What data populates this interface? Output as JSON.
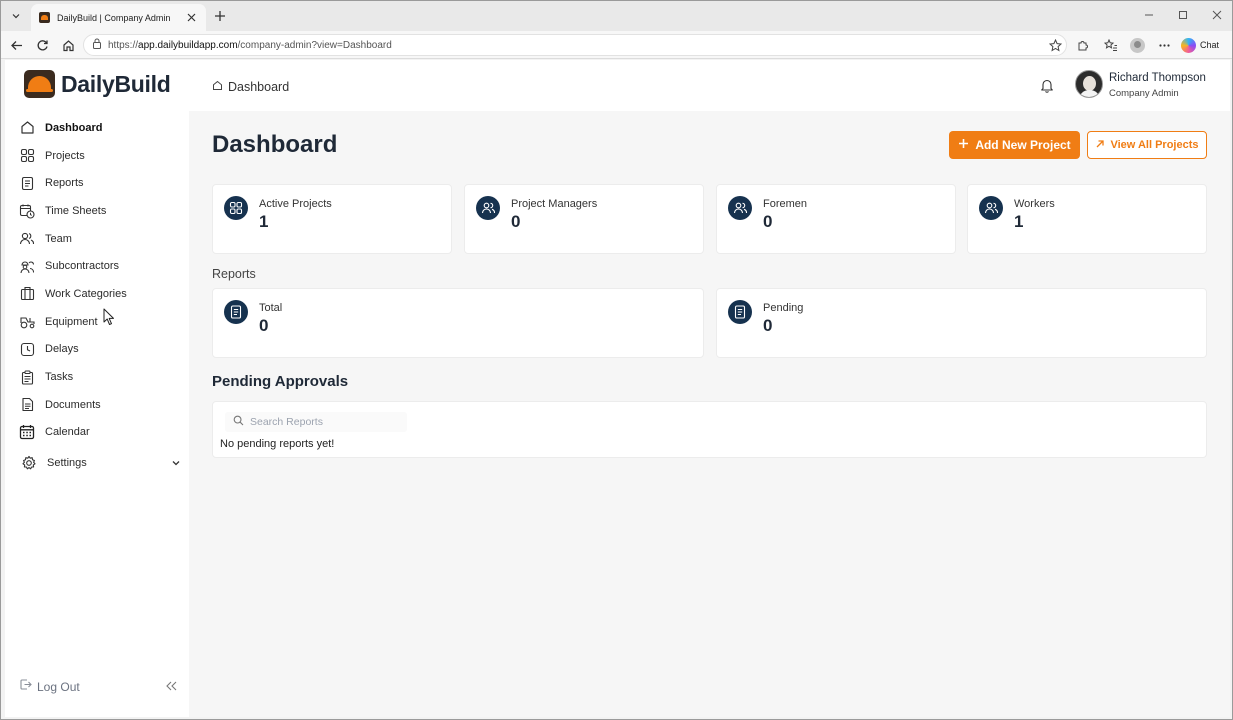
{
  "browser": {
    "tab_title": "DailyBuild | Company Admin",
    "url_prefix": "https://",
    "url_host": "app.dailybuildapp.com",
    "url_path": "/company-admin?view=Dashboard",
    "chat_label": "Chat"
  },
  "brand": {
    "name": "DailyBuild",
    "accent": "#f07d14",
    "dark": "#16324f"
  },
  "sidebar": {
    "items": [
      {
        "label": "Dashboard",
        "icon": "home-icon",
        "active": true
      },
      {
        "label": "Projects",
        "icon": "grid-icon"
      },
      {
        "label": "Reports",
        "icon": "document-icon"
      },
      {
        "label": "Time Sheets",
        "icon": "calendar-clock-icon"
      },
      {
        "label": "Team",
        "icon": "users-icon"
      },
      {
        "label": "Subcontractors",
        "icon": "workers-icon"
      },
      {
        "label": "Work Categories",
        "icon": "building-icon"
      },
      {
        "label": "Equipment",
        "icon": "tractor-icon"
      },
      {
        "label": "Delays",
        "icon": "clock-icon"
      },
      {
        "label": "Tasks",
        "icon": "clipboard-icon"
      },
      {
        "label": "Documents",
        "icon": "file-icon"
      },
      {
        "label": "Calendar",
        "icon": "calendar-icon"
      }
    ],
    "settings_label": "Settings",
    "logout_label": "Log Out"
  },
  "topbar": {
    "breadcrumb": "Dashboard",
    "user_name": "Richard Thompson",
    "user_role": "Company Admin"
  },
  "main": {
    "title": "Dashboard",
    "add_button": "Add New Project",
    "view_all_button": "View All Projects",
    "stats": [
      {
        "label": "Active Projects",
        "value": "1",
        "icon": "grid-icon"
      },
      {
        "label": "Project Managers",
        "value": "0",
        "icon": "users-icon"
      },
      {
        "label": "Foremen",
        "value": "0",
        "icon": "users-icon"
      },
      {
        "label": "Workers",
        "value": "1",
        "icon": "users-icon"
      }
    ],
    "reports_label": "Reports",
    "report_stats": [
      {
        "label": "Total",
        "value": "0",
        "icon": "document-icon"
      },
      {
        "label": "Pending",
        "value": "0",
        "icon": "document-icon"
      }
    ],
    "pending_heading": "Pending Approvals",
    "search_placeholder": "Search Reports",
    "empty_message": "No pending reports yet!"
  }
}
